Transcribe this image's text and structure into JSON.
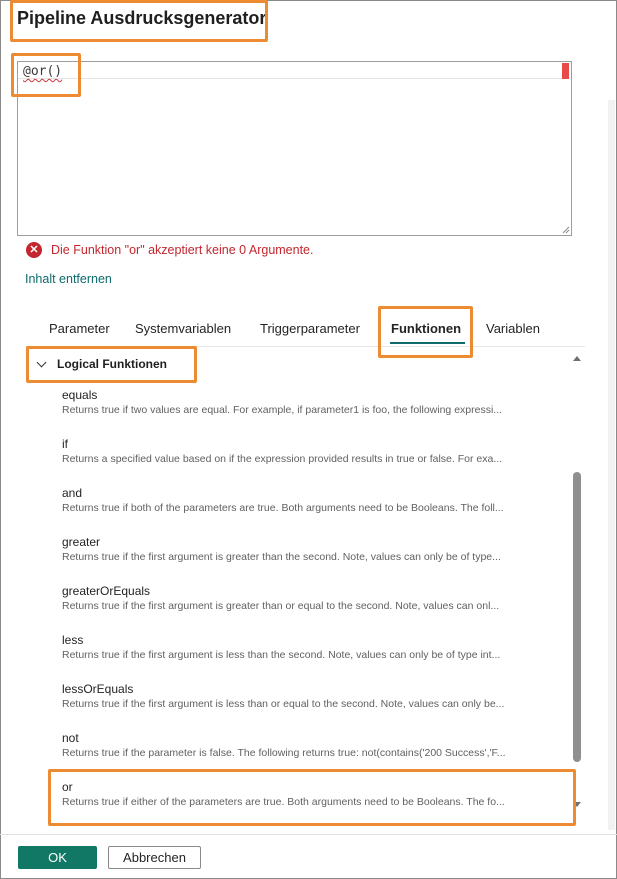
{
  "dialog": {
    "title": "Pipeline Ausdrucksgenerator"
  },
  "editor": {
    "value": "@or()"
  },
  "validation": {
    "error_text": "Die Funktion \"or\" akzeptiert keine 0 Argumente."
  },
  "actions": {
    "remove_content_label": "Inhalt entfernen"
  },
  "tabs": [
    {
      "label": "Parameter"
    },
    {
      "label": "Systemvariablen"
    },
    {
      "label": "Triggerparameter"
    },
    {
      "label": "Funktionen"
    },
    {
      "label": "Variablen"
    }
  ],
  "active_tab": "Funktionen",
  "functions_section": {
    "label": "Logical Funktionen",
    "items": [
      {
        "name": "equals",
        "description": "Returns true if two values are equal. For example, if parameter1 is foo, the following expressi..."
      },
      {
        "name": "if",
        "description": "Returns a specified value based on if the expression provided results in true or false. For exa..."
      },
      {
        "name": "and",
        "description": "Returns true if both of the parameters are true. Both arguments need to be Booleans. The foll..."
      },
      {
        "name": "greater",
        "description": "Returns true if the first argument is greater than the second. Note, values can only be of type..."
      },
      {
        "name": "greaterOrEquals",
        "description": "Returns true if the first argument is greater than or equal to the second. Note, values can onl..."
      },
      {
        "name": "less",
        "description": "Returns true if the first argument is less than the second. Note, values can only be of type int..."
      },
      {
        "name": "lessOrEquals",
        "description": "Returns true if the first argument is less than or equal to the second. Note, values can only be..."
      },
      {
        "name": "not",
        "description": "Returns true if the parameter is false. The following returns true: not(contains('200 Success','F..."
      },
      {
        "name": "or",
        "description": "Returns true if either of the parameters are true. Both arguments need to be Booleans. The fo..."
      }
    ]
  },
  "footer": {
    "ok_label": "OK",
    "cancel_label": "Abbrechen"
  },
  "colors": {
    "highlight": "#ed8b33",
    "error": "#c4262e",
    "accent": "#117865",
    "link": "#0f6b6b"
  }
}
